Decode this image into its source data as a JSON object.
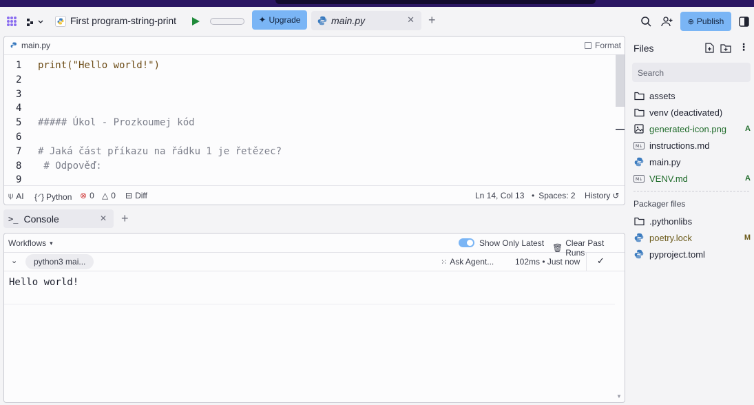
{
  "app": {
    "title": "First program-string-print",
    "upgrade_label": "Upgrade",
    "publish_label": "Publish"
  },
  "tabs": [
    {
      "label": "main.py"
    }
  ],
  "editor": {
    "filename": "main.py",
    "format_label": "Format",
    "lines": [
      {
        "n": "1",
        "code": "print(\"Hello world!\")"
      },
      {
        "n": "2",
        "code": ""
      },
      {
        "n": "3",
        "code": ""
      },
      {
        "n": "4",
        "code": ""
      },
      {
        "n": "5",
        "code": "##### Úkol - Prozkoumej kód"
      },
      {
        "n": "6",
        "code": ""
      },
      {
        "n": "7",
        "code": "# Jaká část příkazu na řádku 1 je řetězec?"
      },
      {
        "n": "8",
        "code": " # Odpověď:"
      },
      {
        "n": "9",
        "code": ""
      }
    ],
    "status": {
      "ai": "AI",
      "lang": "Python",
      "errors": "0",
      "warnings": "0",
      "diff": "Diff",
      "position": "Ln 14, Col 13",
      "spaces": "Spaces: 2",
      "history": "History"
    }
  },
  "console": {
    "tab_label": "Console",
    "workflows_label": "Workflows",
    "show_only_latest": "Show Only Latest",
    "clear_label": "Clear Past Runs",
    "run_name": "python3 mai...",
    "ask_agent": "Ask Agent...",
    "timing": "102ms • Just now",
    "output": "Hello world!"
  },
  "files": {
    "title": "Files",
    "search_placeholder": "Search",
    "items": [
      {
        "name": "assets",
        "icon": "folder-icon",
        "badge": ""
      },
      {
        "name": "venv (deactivated)",
        "icon": "folder-icon",
        "badge": ""
      },
      {
        "name": "generated-icon.png",
        "icon": "image-icon",
        "badge": "A"
      },
      {
        "name": "instructions.md",
        "icon": "markdown-icon",
        "badge": ""
      },
      {
        "name": "main.py",
        "icon": "python-icon",
        "badge": ""
      },
      {
        "name": "VENV.md",
        "icon": "markdown-icon",
        "badge": "A"
      }
    ],
    "packager_title": "Packager files",
    "packager_items": [
      {
        "name": ".pythonlibs",
        "icon": "folder-icon",
        "badge": ""
      },
      {
        "name": "poetry.lock",
        "icon": "python-icon",
        "badge": "M"
      },
      {
        "name": "pyproject.toml",
        "icon": "python-icon",
        "badge": ""
      }
    ]
  },
  "colors": {
    "accent": "#7ab5f5",
    "added": "#1f6b2a",
    "modified": "#6b5a1a",
    "header_strip": "#2b1663"
  }
}
